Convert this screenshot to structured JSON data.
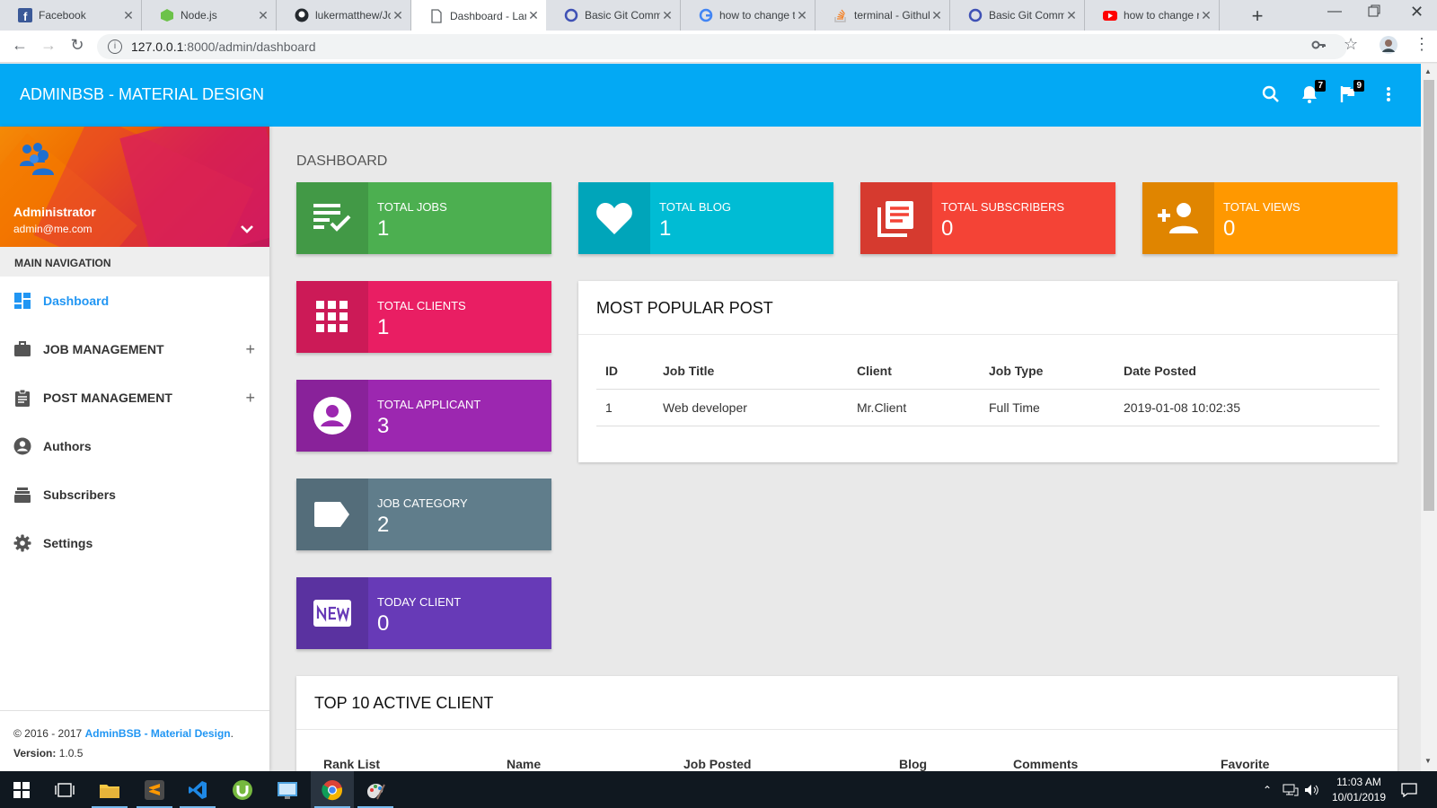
{
  "browser": {
    "tabs": [
      {
        "title": "Facebook",
        "icon": "facebook-icon"
      },
      {
        "title": "Node.js",
        "icon": "nodejs-icon"
      },
      {
        "title": "lukermatthew/Jo",
        "icon": "github-icon"
      },
      {
        "title": "Dashboard - Lar",
        "icon": "document-icon",
        "active": true
      },
      {
        "title": "Basic Git Comma",
        "icon": "circle-icon"
      },
      {
        "title": "how to change t",
        "icon": "google-icon"
      },
      {
        "title": "terminal - Githul",
        "icon": "stackoverflow-icon"
      },
      {
        "title": "Basic Git Comma",
        "icon": "circle-icon"
      },
      {
        "title": "how to change r",
        "icon": "youtube-icon"
      }
    ],
    "url_host": "127.0.0.1",
    "url_path": ":8000/admin/dashboard"
  },
  "appbar": {
    "brand": "ADMINBSB - MATERIAL DESIGN",
    "notifications_count": "7",
    "flags_count": "9"
  },
  "user": {
    "name": "Administrator",
    "email": "admin@me.com"
  },
  "sidebar": {
    "header": "MAIN NAVIGATION",
    "items": [
      {
        "label": "Dashboard",
        "icon": "dashboard-icon"
      },
      {
        "label": "JOB MANAGEMENT",
        "icon": "briefcase-icon"
      },
      {
        "label": "POST MANAGEMENT",
        "icon": "clipboard-icon"
      },
      {
        "label": "Authors",
        "icon": "account-circle-icon"
      },
      {
        "label": "Subscribers",
        "icon": "stack-icon"
      },
      {
        "label": "Settings",
        "icon": "gear-icon"
      }
    ],
    "footer_copyright": "© 2016 - 2017 ",
    "footer_link": "AdminBSB - Material Design",
    "footer_period": ".",
    "footer_version_label": "Version: ",
    "footer_version": "1.0.5"
  },
  "dashboard": {
    "title": "DASHBOARD",
    "stats": [
      {
        "label": "TOTAL JOBS",
        "value": "1",
        "color": "#4caf50",
        "icon": "playlist-check-icon"
      },
      {
        "label": "TOTAL BLOG",
        "value": "1",
        "color": "#00bcd4",
        "icon": "heart-icon"
      },
      {
        "label": "TOTAL SUBSCRIBERS",
        "value": "0",
        "color": "#f44336",
        "icon": "library-books-icon"
      },
      {
        "label": "TOTAL VIEWS",
        "value": "0",
        "color": "#ff9800",
        "icon": "person-add-icon"
      },
      {
        "label": "TOTAL CLIENTS",
        "value": "1",
        "color": "#e91e63",
        "icon": "apps-grid-icon"
      },
      {
        "label": "TOTAL APPLICANT",
        "value": "3",
        "color": "#9c27b0",
        "icon": "account-circle-icon"
      },
      {
        "label": "JOB CATEGORY",
        "value": "2",
        "color": "#607d8b",
        "icon": "label-icon"
      },
      {
        "label": "TODAY CLIENT",
        "value": "0",
        "color": "#673ab7",
        "icon": "new-badge-icon"
      }
    ]
  },
  "popular_post": {
    "title": "MOST POPULAR POST",
    "headers": [
      "ID",
      "Job Title",
      "Client",
      "Job Type",
      "Date Posted"
    ],
    "rows": [
      [
        "1",
        "Web developer",
        "Mr.Client",
        "Full Time",
        "2019-01-08 10:02:35"
      ]
    ]
  },
  "top_clients": {
    "title": "TOP 10 ACTIVE CLIENT",
    "headers": [
      "Rank List",
      "Name",
      "Job Posted",
      "Blog",
      "Comments",
      "Favorite"
    ]
  },
  "taskbar": {
    "time": "11:03 AM",
    "date": "10/01/2019"
  }
}
